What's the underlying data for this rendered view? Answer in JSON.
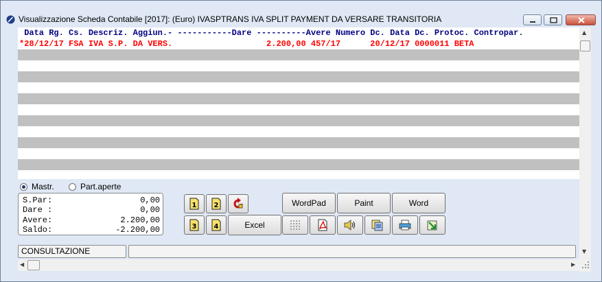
{
  "window": {
    "title": "Visualizzazione Scheda Contabile [2017]:  (Euro)  IVASPTRANS IVA SPLIT PAYMENT DA VERSARE TRANSITORIA"
  },
  "ledger": {
    "header": " Data Rg. Cs. Descriz. Aggiun.- -----------Dare ----------Avere Numero Dc. Data Dc. Protoc. Contropar.",
    "rows": [
      "*28/12/17 FSA IVA S.P. DA VERS.                   2.200,00 457/17      20/12/17 0000011 BETA"
    ]
  },
  "view_mode": {
    "option_mastr": "Mastr.",
    "option_part": "Part.aperte",
    "selected": "Mastr."
  },
  "summary": {
    "spar_label": "S.Par:",
    "spar_value": "0,00",
    "dare_label": "Dare :",
    "dare_value": "0,00",
    "avere_label": "Avere:",
    "avere_value": "2.200,00",
    "saldo_label": "Saldo:",
    "saldo_value": "-2.200,00"
  },
  "buttons": {
    "wordpad": "WordPad",
    "paint": "Paint",
    "word": "Word",
    "excel": "Excel"
  },
  "status": {
    "mode": "CONSULTAZIONE"
  },
  "colors": {
    "header_text": "#000080",
    "entry_text": "#ff0000",
    "stripe": "#c0c0c0"
  }
}
